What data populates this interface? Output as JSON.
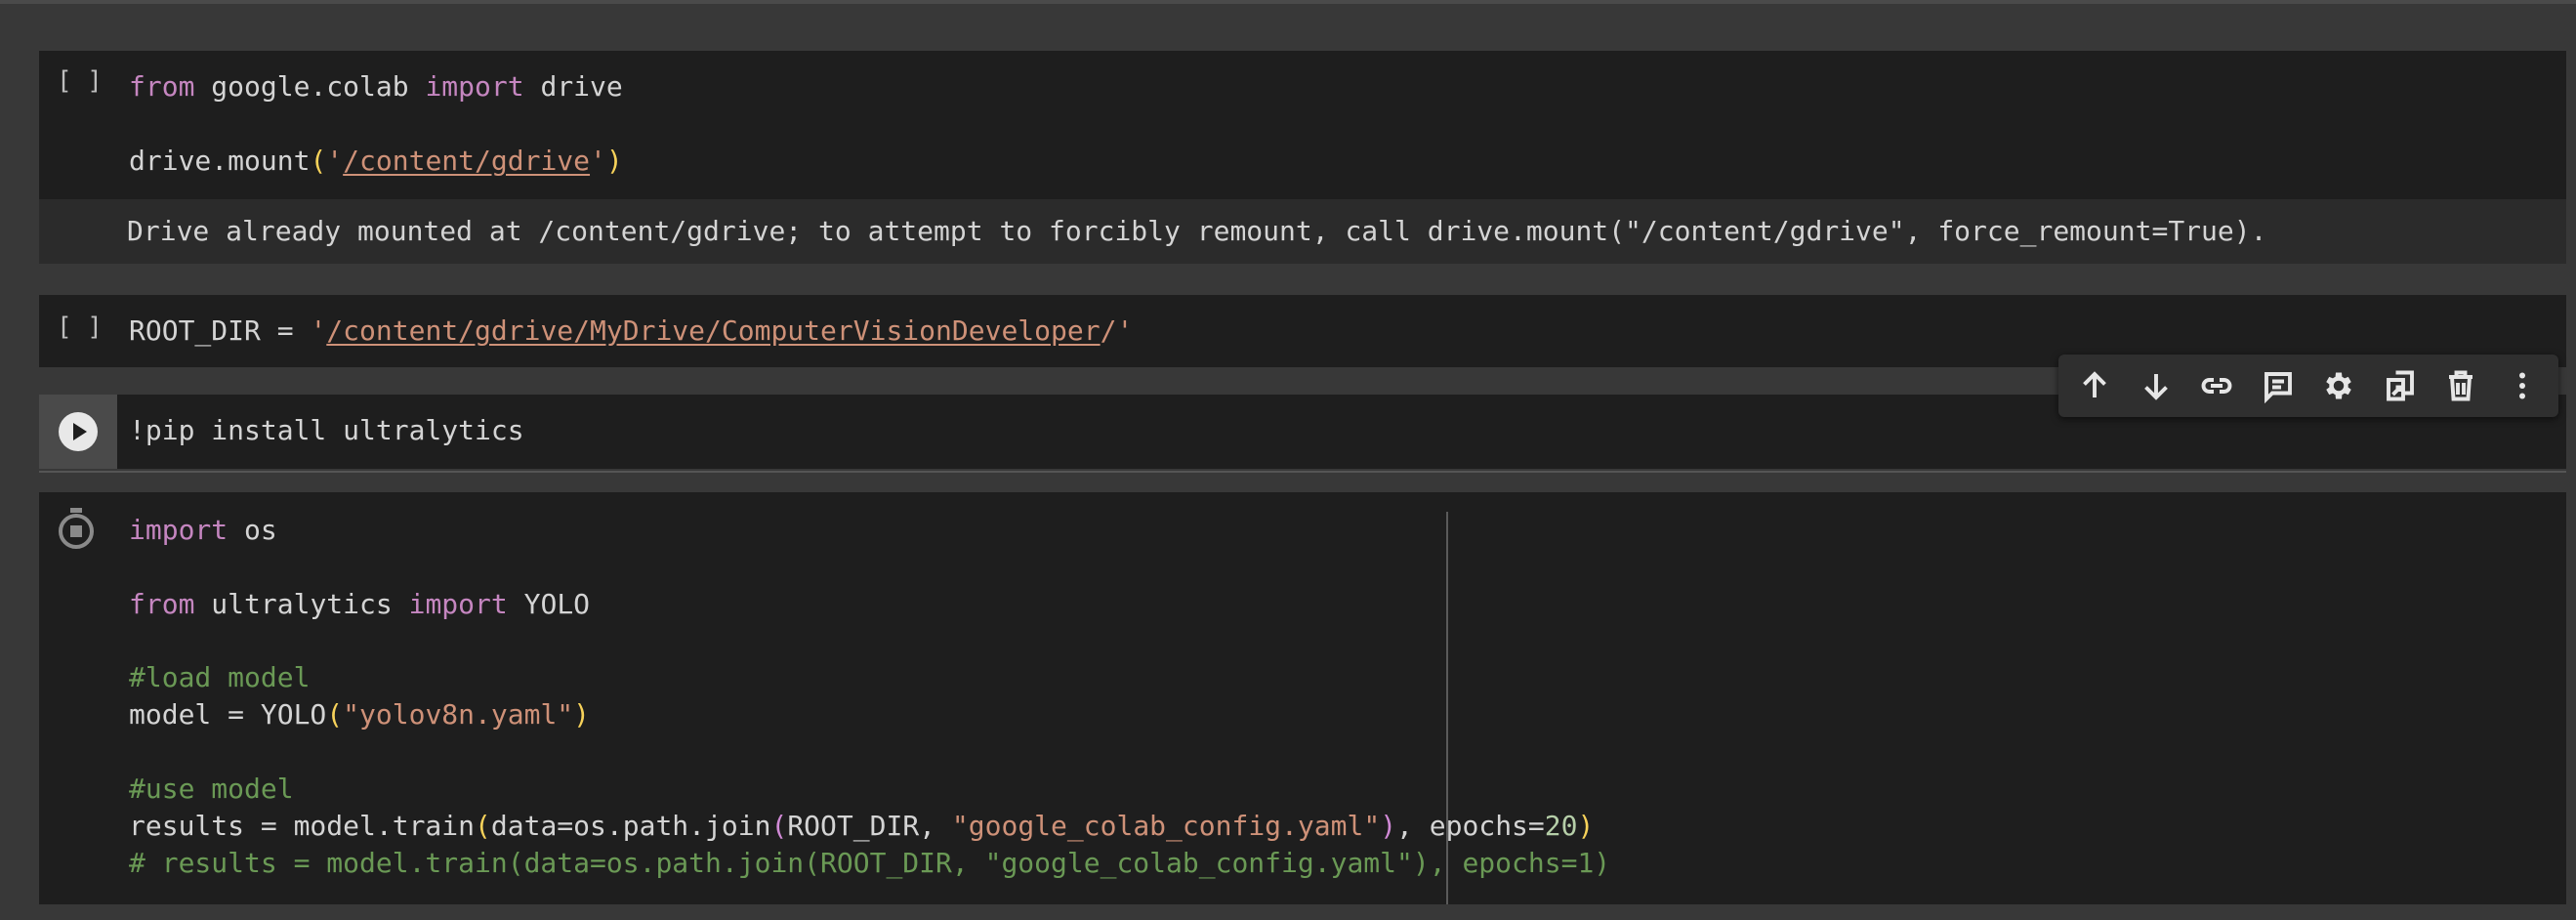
{
  "cells": [
    {
      "bracket": "[ ]",
      "lines": [
        {
          "kw1": "from",
          "t1": " google.colab ",
          "kw2": "import",
          "t2": " drive"
        },
        {
          "a": "drive.mount",
          "p1": "(",
          "q1": "'",
          "s": "/content/gdrive",
          "q2": "'",
          "p2": ")"
        }
      ],
      "output": "Drive already mounted at /content/gdrive; to attempt to forcibly remount, call drive.mount(\"/content/gdrive\", force_remount=True)."
    },
    {
      "bracket": "[ ]",
      "a": "ROOT_DIR = ",
      "q1": "'",
      "s": "/content/gdrive/MyDrive/ComputerVisionDeveloper",
      "q2": "/'"
    },
    {
      "code": "!pip install ultralytics"
    },
    {
      "l1_kw": "import",
      "l1_t": " os",
      "l2_kw1": "from",
      "l2_t1": " ultralytics ",
      "l2_kw2": "import",
      "l2_t2": " YOLO",
      "l3_com": "#load model",
      "l4_a": "model = YOLO",
      "l4_p1": "(",
      "l4_s": "\"yolov8n.yaml\"",
      "l4_p2": ")",
      "l5_com": "#use model",
      "l6_a": "results = model.train",
      "l6_p1": "(",
      "l6_b": "data=os.path.join",
      "l6_p2": "(",
      "l6_c": "ROOT_DIR, ",
      "l6_s": "\"google_colab_config.yaml\"",
      "l6_p3": ")",
      "l6_d": ", epochs=",
      "l6_n": "20",
      "l6_p4": ")",
      "l7_com": "# results = model.train(data=os.path.join(ROOT_DIR, \"google_colab_config.yaml\"), epochs=1)"
    }
  ],
  "toolbar": {
    "icons": [
      "arrow-up-icon",
      "arrow-down-icon",
      "link-icon",
      "comment-icon",
      "gear-icon",
      "mirror-cell-icon",
      "trash-icon",
      "more-vert-icon"
    ]
  }
}
